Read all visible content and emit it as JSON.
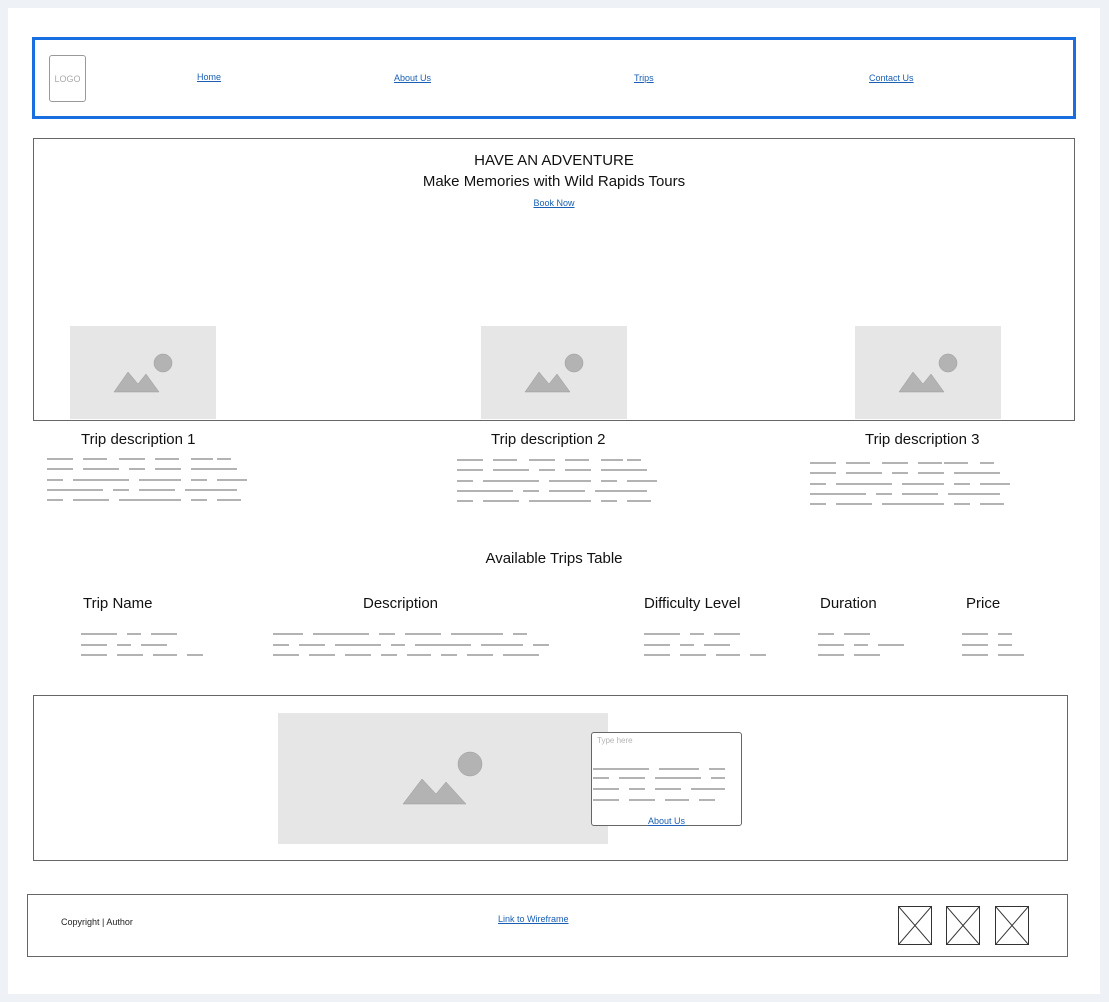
{
  "header": {
    "logo": "LOGO",
    "nav": [
      "Home",
      "About Us",
      "Trips",
      "Contact Us"
    ]
  },
  "hero": {
    "title": "HAVE AN ADVENTURE",
    "subtitle": "Make Memories with Wild Rapids Tours",
    "cta": "Book Now"
  },
  "trips": [
    {
      "title": "Trip description 1"
    },
    {
      "title": "Trip description 2"
    },
    {
      "title": "Trip description 3"
    }
  ],
  "table": {
    "title": "Available Trips Table",
    "headers": [
      "Trip Name",
      "Description",
      "Difficulty Level",
      "Duration",
      "Price"
    ]
  },
  "about": {
    "input_placeholder": "Type here",
    "link": "About Us"
  },
  "footer": {
    "copyright": "Copyright | Author",
    "link": "Link to Wireframe",
    "social_icons": [
      "social-placeholder-icon-1",
      "social-placeholder-icon-2",
      "social-placeholder-icon-3"
    ]
  },
  "colors": {
    "accent_border": "#1a6fe0",
    "link": "#1a5fb4",
    "placeholder_fill": "#e6e6e6",
    "placeholder_shape": "#b3b3b3"
  }
}
